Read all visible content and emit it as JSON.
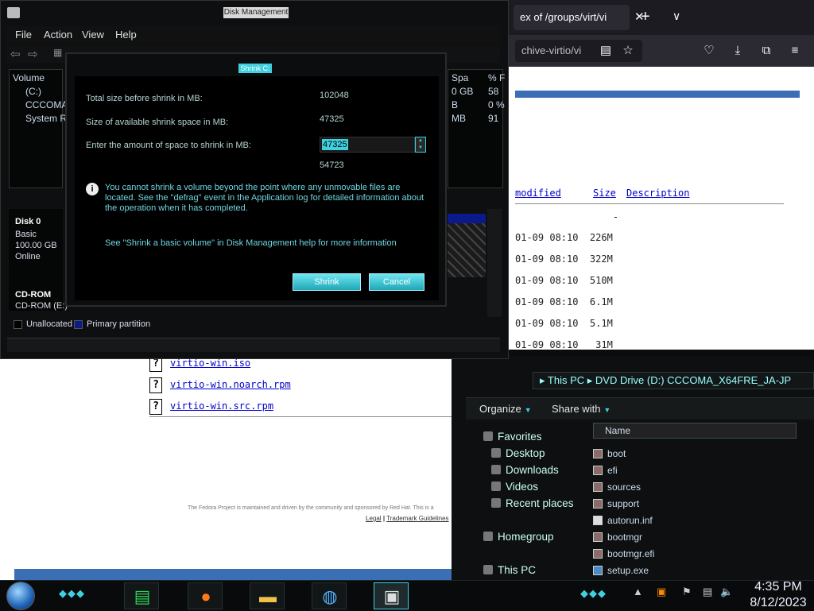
{
  "firefox": {
    "tab_title": "ex of /groups/virt/vi",
    "tab_close": "✕",
    "new_tab": "+",
    "all_tabs": "∨",
    "url": "chive-virtio/vi",
    "columns": {
      "modified": "modified",
      "size": "Size",
      "description": "Description"
    },
    "rows": [
      {
        "text": "                 -"
      },
      {
        "text": "01-09 08:10  226M"
      },
      {
        "text": "01-09 08:10  322M"
      },
      {
        "text": "01-09 08:10  510M"
      },
      {
        "text": "01-09 08:10  6.1M"
      },
      {
        "text": "01-09 08:10  5.1M"
      },
      {
        "text": "01-09 08:10   31M"
      }
    ]
  },
  "webpage": {
    "files": [
      "virtio-win.iso",
      "virtio-win.noarch.rpm",
      "virtio-win.src.rpm"
    ],
    "file_icon": "?",
    "footer": "The Fedora Project is maintained and driven by the community and sponsored by Red Hat. This is a",
    "footer_links": {
      "legal": "Legal",
      "sep": "|",
      "trademark": "Trademark Guidelines"
    }
  },
  "disk_management": {
    "title": "Disk Management",
    "menu": [
      "File",
      "Action",
      "View",
      "Help"
    ],
    "volume_header": "Volume",
    "volumes": [
      "(C:)",
      "CCCOMA",
      "System R"
    ],
    "right_cols": [
      {
        "a": "Spa",
        "b": "% F"
      },
      {
        "a": "0 GB",
        "b": "58"
      },
      {
        "a": "B",
        "b": "0 %"
      },
      {
        "a": "MB",
        "b": "91"
      }
    ],
    "disk0": {
      "name": "Disk 0",
      "type": "Basic",
      "size": "100.00 GB",
      "status": "Online"
    },
    "cdrom": {
      "name": "CD-ROM",
      "label": "CD-ROM (E:)"
    },
    "legend": {
      "unallocated": "Unallocated",
      "primary": "Primary partition"
    },
    "colors": {
      "primary": "#0a1a8a",
      "unallocated": "#000000"
    }
  },
  "shrink_dialog": {
    "title": "Shrink C:",
    "total_before_label": "Total size before shrink in MB:",
    "total_before_value": "102048",
    "available_label": "Size of available shrink space in MB:",
    "available_value": "47325",
    "enter_label": "Enter the amount of space to shrink in MB:",
    "enter_value": "47325",
    "after_label": "Total size after shrink in MB:",
    "after_value": "54723",
    "info_text": "You cannot shrink a volume beyond the point where any unmovable files are located. See the \"defrag\" event in the Application log for detailed information about the operation when it has completed.",
    "help_text": "See \"Shrink a basic volume\" in Disk Management help for more information",
    "shrink_button": "Shrink",
    "cancel_button": "Cancel"
  },
  "explorer": {
    "breadcrumb": "▸ This PC ▸ DVD Drive (D:) CCCOMA_X64FRE_JA-JP",
    "organize": "Organize",
    "share_with": "Share with",
    "nav": {
      "favorites": "Favorites",
      "desktop": "Desktop",
      "downloads": "Downloads",
      "videos": "Videos",
      "recent": "Recent places",
      "homegroup": "Homegroup",
      "this_pc": "This PC"
    },
    "name_header": "Name",
    "files": [
      "boot",
      "efi",
      "sources",
      "support",
      "autorun.inf",
      "bootmgr",
      "bootmgr.efi",
      "setup.exe"
    ]
  },
  "taskbar": {
    "time": "4:35 PM",
    "date": "8/12/2023",
    "accent": "#3fd0e0"
  }
}
